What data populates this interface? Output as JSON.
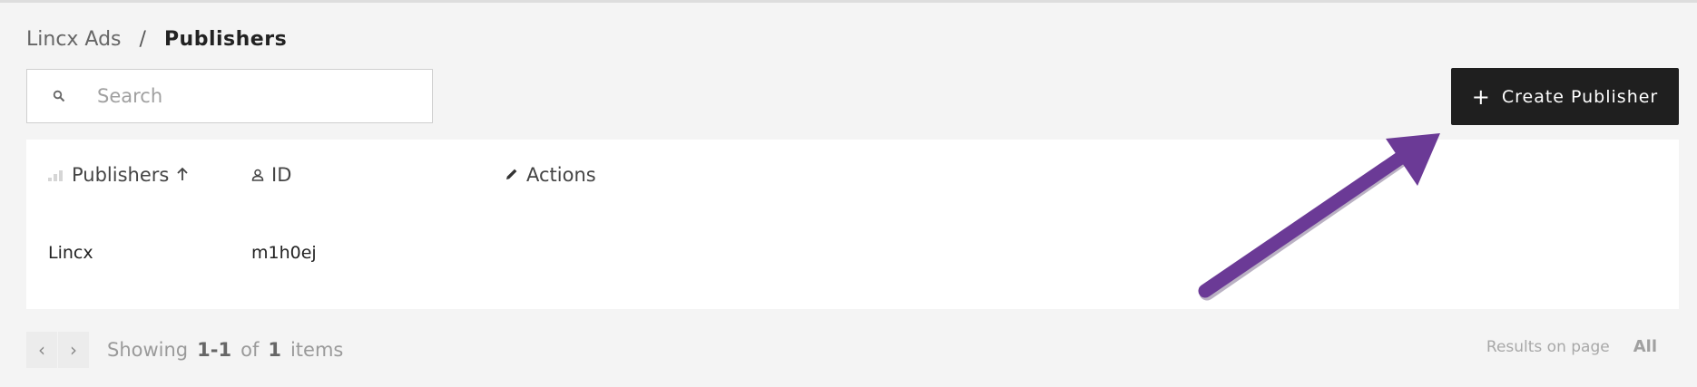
{
  "breadcrumb": {
    "root": "Lincx Ads",
    "separator": "/",
    "current": "Publishers"
  },
  "search": {
    "placeholder": "Search",
    "value": "",
    "icon": "search-icon"
  },
  "toolbar": {
    "create_label": "Create Publisher",
    "create_icon": "plus-icon"
  },
  "table": {
    "columns": [
      {
        "label": "Publishers",
        "icon": "bar-chart-icon",
        "sort": "ascending"
      },
      {
        "label": "ID",
        "icon": "user-icon"
      },
      {
        "label": "Actions",
        "icon": "pencil-icon"
      }
    ],
    "rows": [
      {
        "name": "Lincx",
        "id": "m1h0ej"
      }
    ]
  },
  "pagination": {
    "showing_label": "Showing",
    "range": "1-1",
    "of_label": "of",
    "total": "1",
    "items_label": "items",
    "results_label": "Results on page",
    "results_value": "All"
  },
  "annotation": {
    "arrow_color": "#6b3a96",
    "points_to": "create-publisher-button"
  },
  "colors": {
    "button_bg": "#1f1f1f",
    "panel_bg": "#ffffff",
    "page_bg": "#f4f4f4"
  }
}
